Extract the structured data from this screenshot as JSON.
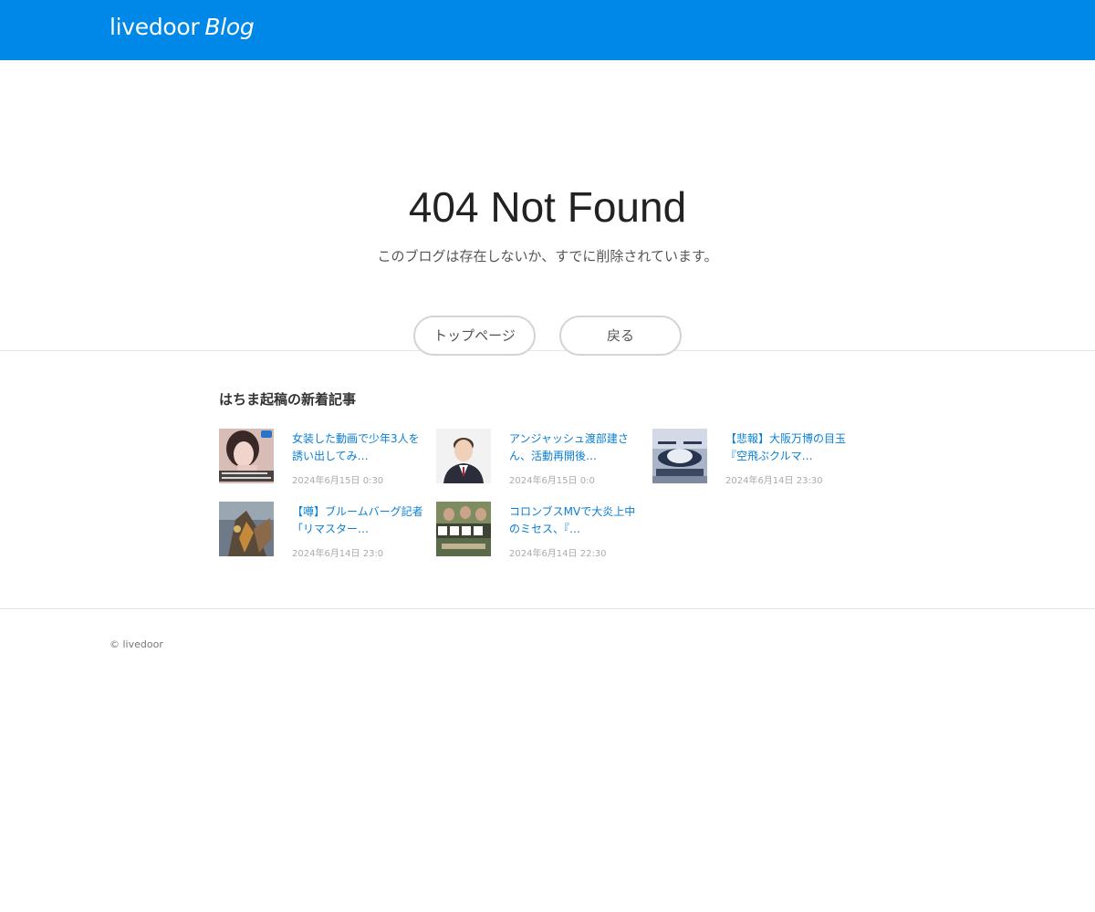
{
  "header": {
    "logo_main": "livedoor",
    "logo_blog": "Blog"
  },
  "main": {
    "title": "404 Not Found",
    "message": "このブログは存在しないか、すでに削除されています。",
    "top_button": "トップページ",
    "back_button": "戻る"
  },
  "articles": {
    "section_title": "はちま起稿の新着記事",
    "items": [
      {
        "title": "女装した動画で少年3人を誘い出してみ…",
        "date": "2024年6月15日 0:30"
      },
      {
        "title": "アンジャッシュ渡部建さん、活動再開後…",
        "date": "2024年6月15日 0:0"
      },
      {
        "title": "【悲報】大阪万博の目玉『空飛ぶクルマ…",
        "date": "2024年6月14日 23:30"
      },
      {
        "title": "【噂】ブルームバーグ記者「リマスター…",
        "date": "2024年6月14日 23:0"
      },
      {
        "title": "コロンブスMVで大炎上中のミセス、『…",
        "date": "2024年6月14日 22:30"
      }
    ]
  },
  "footer": {
    "copyright": "© livedoor"
  }
}
